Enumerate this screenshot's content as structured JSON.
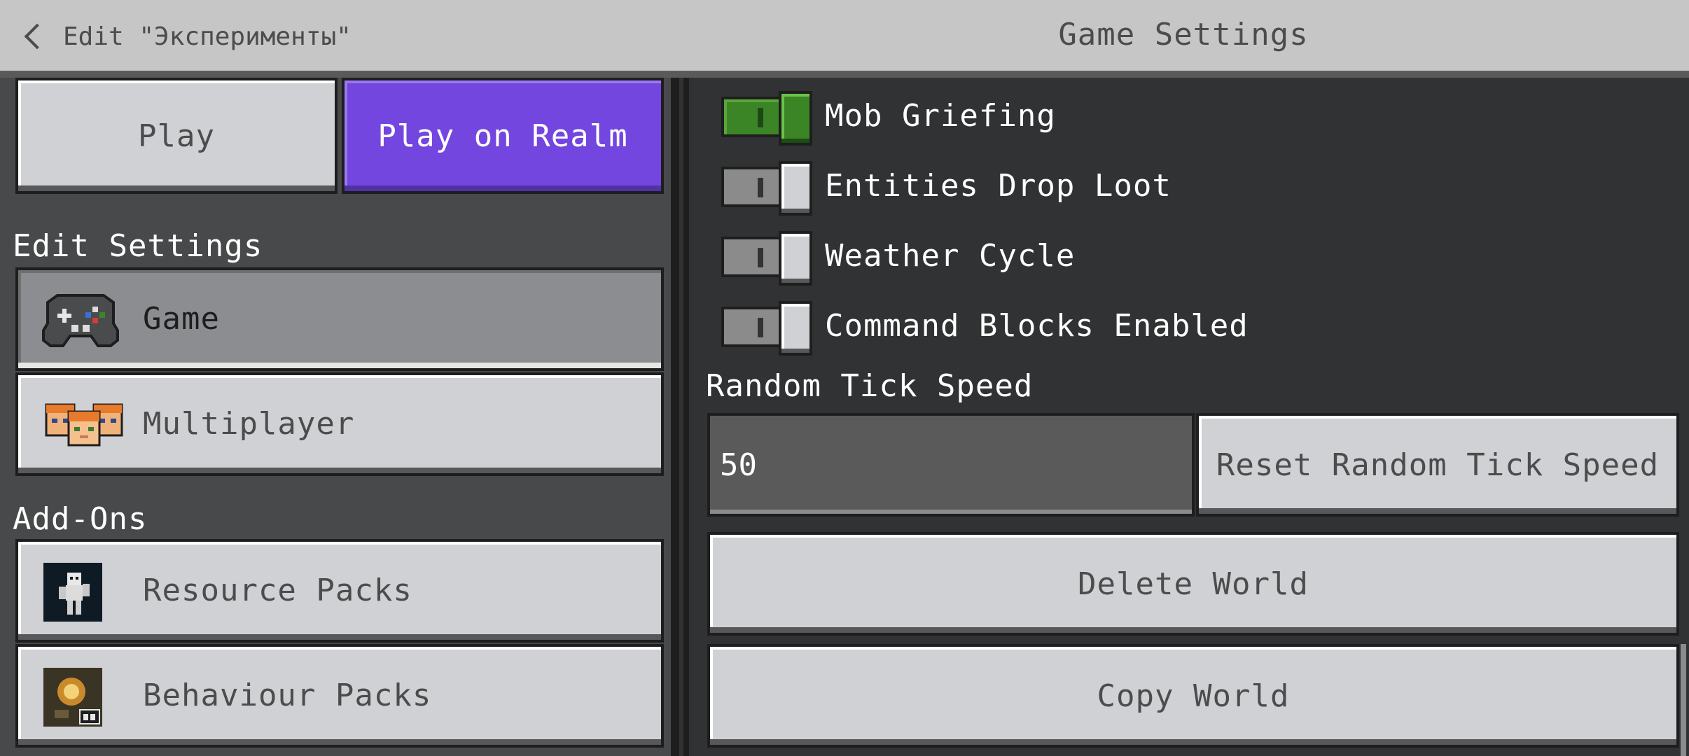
{
  "header": {
    "back_label": "Edit \"Эксперименты\"",
    "title": "Game Settings"
  },
  "left": {
    "play_label": "Play",
    "realm_label": "Play on Realm",
    "edit_settings_label": "Edit Settings",
    "game_label": "Game",
    "multiplayer_label": "Multiplayer",
    "addons_label": "Add-Ons",
    "resource_packs_label": "Resource Packs",
    "behaviour_packs_label": "Behaviour Packs"
  },
  "right": {
    "toggles": [
      {
        "label": "Mob Griefing",
        "on": true
      },
      {
        "label": "Entities Drop Loot",
        "on": false
      },
      {
        "label": "Weather Cycle",
        "on": false
      },
      {
        "label": "Command Blocks Enabled",
        "on": false
      }
    ],
    "random_tick_label": "Random Tick Speed",
    "random_tick_value": "50",
    "reset_tick_label": "Reset Random Tick Speed",
    "delete_world_label": "Delete World",
    "copy_world_label": "Copy World"
  },
  "colors": {
    "realm_purple": "#7346df",
    "toggle_on_green": "#3c8527",
    "panel_dark": "#313233",
    "header_gray": "#c6c6c6"
  },
  "icons": {
    "back": "chevron-left-icon",
    "game": "gamepad-icon",
    "multiplayer": "players-faces-icon",
    "resource_packs": "resource-pack-icon",
    "behaviour_packs": "behaviour-pack-icon"
  }
}
